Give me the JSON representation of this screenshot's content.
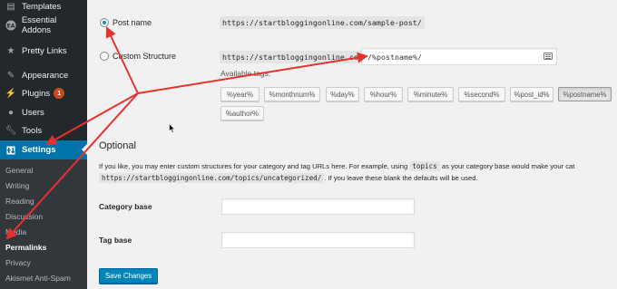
{
  "sidebar": {
    "items": [
      {
        "label": "Templates",
        "icon": "templates-icon"
      },
      {
        "label": "Essential Addons",
        "icon": "ea-icon"
      },
      {
        "label": "Pretty Links",
        "icon": "star-icon"
      },
      {
        "label": "Appearance",
        "icon": "appearance-icon"
      },
      {
        "label": "Plugins",
        "icon": "plugins-icon",
        "badge": "1"
      },
      {
        "label": "Users",
        "icon": "users-icon"
      },
      {
        "label": "Tools",
        "icon": "tools-icon"
      },
      {
        "label": "Settings",
        "icon": "settings-icon"
      }
    ],
    "submenu": [
      "General",
      "Writing",
      "Reading",
      "Discussion",
      "Media",
      "Permalinks",
      "Privacy",
      "Akismet Anti-Spam"
    ]
  },
  "permalinks": {
    "post_name_label": "Post name",
    "post_name_example": "https://startbloggingonline.com/sample-post/",
    "custom_label": "Custom Structure",
    "custom_prefix": "https://startbloggingonline.com",
    "custom_value": "/%postname%/",
    "available_tags_label": "Available tags:",
    "tags": [
      "%year%",
      "%monthnum%",
      "%day%",
      "%hour%",
      "%minute%",
      "%second%",
      "%post_id%",
      "%postname%",
      "%author%"
    ],
    "active_tag": "%postname%"
  },
  "optional": {
    "heading": "Optional",
    "desc_line1_a": "If you like, you may enter custom structures for your category and tag URLs here. For example, using",
    "desc_code": "topics",
    "desc_line1_b": "as your category base would make your cat",
    "desc_line2_code": "https://startbloggingonline.com/topics/uncategorized/",
    "desc_line2_b": ". If you leave these blank the defaults will be used.",
    "category_base_label": "Category base",
    "category_base_value": "",
    "tag_base_label": "Tag base",
    "tag_base_value": ""
  },
  "save_button": "Save Changes",
  "colors": {
    "sidebar_bg": "#23282d",
    "accent": "#0073aa",
    "annotation": "#e8312f"
  }
}
